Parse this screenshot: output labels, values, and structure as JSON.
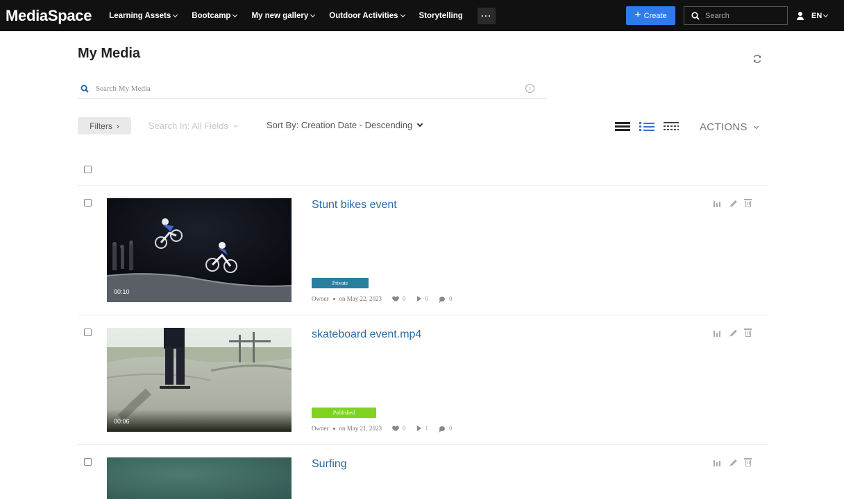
{
  "app": {
    "logo": "MediaSpace"
  },
  "nav": {
    "items": [
      {
        "label": "Learning Assets",
        "dropdown": true
      },
      {
        "label": "Bootcamp",
        "dropdown": true
      },
      {
        "label": "My new gallery",
        "dropdown": true
      },
      {
        "label": "Outdoor Activities",
        "dropdown": true
      },
      {
        "label": "Storytelling",
        "dropdown": false
      }
    ],
    "more_label": "···",
    "create_label": "Create",
    "search_placeholder": "Search",
    "language": "EN"
  },
  "page": {
    "title": "My Media",
    "search_placeholder": "Search My Media"
  },
  "toolbar": {
    "filters_label": "Filters",
    "search_in_label": "Search In: All Fields",
    "sort_label": "Sort By: Creation Date - Descending",
    "actions_label": "ACTIONS"
  },
  "colors": {
    "topbar": "#111111",
    "create_button": "#2f7bea",
    "title_link": "#2a6aa3",
    "private_badge": "#2a7f9e",
    "published_badge": "#7ed321"
  },
  "media": [
    {
      "title": "Stunt bikes event",
      "duration": "00:10",
      "status": "Private",
      "owner": "Owner",
      "date": "on May 22, 2023",
      "likes": "0",
      "plays": "0",
      "comments": "0"
    },
    {
      "title": "skateboard event.mp4",
      "duration": "00:06",
      "status": "Published",
      "owner": "Owner",
      "date": "on May 21, 2023",
      "likes": "0",
      "plays": "1",
      "comments": "0"
    },
    {
      "title": "Surfing"
    }
  ]
}
